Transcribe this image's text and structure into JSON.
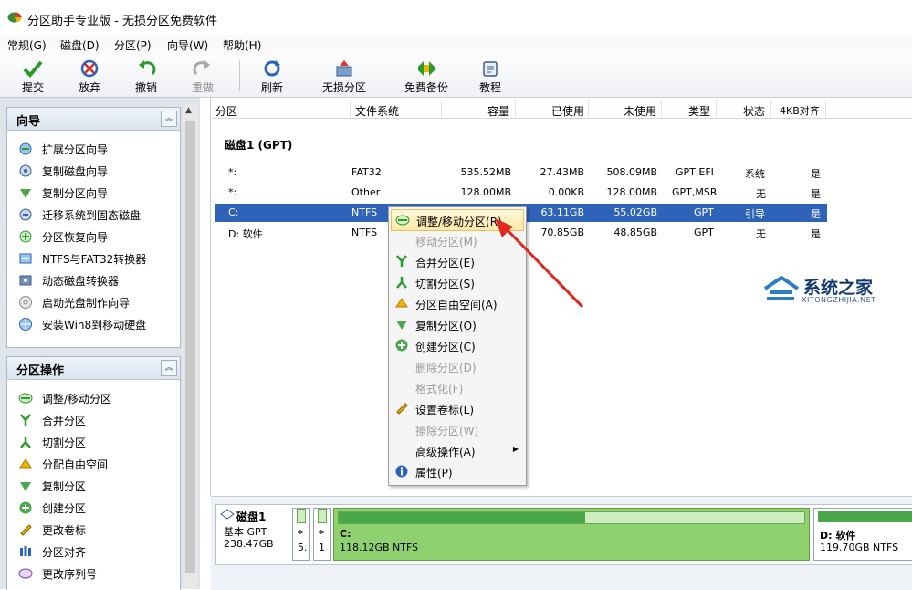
{
  "window": {
    "title": "分区助手专业版 - 无损分区免费软件"
  },
  "menubar": [
    "常规(G)",
    "磁盘(D)",
    "分区(P)",
    "向导(W)",
    "帮助(H)"
  ],
  "toolbar": {
    "submit": "提交",
    "discard": "放弃",
    "undo": "撤销",
    "redo": "重做",
    "refresh": "刷新",
    "lossless": "无损分区",
    "backup": "免费备份",
    "tutorial": "教程"
  },
  "wizard_panel": {
    "title": "向导",
    "items": [
      "扩展分区向导",
      "复制磁盘向导",
      "复制分区向导",
      "迁移系统到固态磁盘",
      "分区恢复向导",
      "NTFS与FAT32转换器",
      "动态磁盘转换器",
      "启动光盘制作向导",
      "安装Win8到移动硬盘"
    ]
  },
  "ops_panel": {
    "title": "分区操作",
    "items": [
      "调整/移动分区",
      "合并分区",
      "切割分区",
      "分配自由空间",
      "复制分区",
      "创建分区",
      "更改卷标",
      "分区对齐",
      "更改序列号"
    ]
  },
  "table": {
    "columns": [
      "分区",
      "文件系统",
      "容量",
      "已使用",
      "未使用",
      "类型",
      "状态",
      "4KB对齐"
    ],
    "disk_label": "磁盘1 (GPT)",
    "rows": [
      {
        "part": "*:",
        "fs": "FAT32",
        "cap": "535.52MB",
        "used": "27.43MB",
        "free": "508.09MB",
        "type": "GPT,EFI",
        "status": "系统",
        "align": "是"
      },
      {
        "part": "*:",
        "fs": "Other",
        "cap": "128.00MB",
        "used": "0.00KB",
        "free": "128.00MB",
        "type": "GPT,MSR",
        "status": "无",
        "align": "是"
      },
      {
        "part": "C:",
        "fs": "NTFS",
        "cap": "",
        "used": "63.11GB",
        "free": "55.02GB",
        "type": "GPT",
        "status": "引导",
        "align": "是"
      },
      {
        "part": "D: 软件",
        "fs": "NTFS",
        "cap": "",
        "used": "70.85GB",
        "free": "48.85GB",
        "type": "GPT",
        "status": "无",
        "align": "是"
      }
    ]
  },
  "context_menu": {
    "items": [
      {
        "label": "调整/移动分区(R)",
        "enabled": true
      },
      {
        "label": "移动分区(M)",
        "enabled": false
      },
      {
        "label": "合并分区(E)",
        "enabled": true
      },
      {
        "label": "切割分区(S)",
        "enabled": true
      },
      {
        "label": "分区自由空间(A)",
        "enabled": true
      },
      {
        "label": "复制分区(O)",
        "enabled": true
      },
      {
        "label": "创建分区(C)",
        "enabled": true
      },
      {
        "label": "删除分区(D)",
        "enabled": false
      },
      {
        "label": "格式化(F)",
        "enabled": false
      },
      {
        "label": "设置卷标(L)",
        "enabled": true
      },
      {
        "label": "擦除分区(W)",
        "enabled": false
      },
      {
        "label": "高级操作(A)",
        "enabled": true
      },
      {
        "label": "属性(P)",
        "enabled": true
      }
    ]
  },
  "disk_map": {
    "disk_name": "磁盘1",
    "disk_type": "基本 GPT",
    "disk_size": "238.47GB",
    "seg1": {
      "top": "*",
      "bottom": "5."
    },
    "seg2": {
      "top": "*",
      "bottom": "1"
    },
    "c": {
      "label": "C:",
      "info": "118.12GB NTFS",
      "used_fraction": 0.53
    },
    "d": {
      "label": "D: 软件",
      "info": "119.70GB NTFS"
    }
  },
  "watermark": {
    "name": "系统之家",
    "url": "XITONGZHIJIA.NET"
  },
  "colors": {
    "selection": "#2f63b8",
    "partition_bar": "#8fd16e",
    "arrow": "#e0281e"
  }
}
